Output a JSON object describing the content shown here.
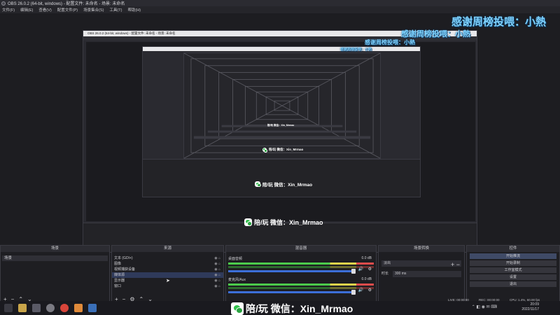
{
  "window": {
    "title": "OBS 26.0.2 (64-bit, windows) - 配置文件: 未命名 - 场景: 未命名"
  },
  "menubar": {
    "items": [
      "文件(F)",
      "编辑(E)",
      "查看(V)",
      "配置文件(P)",
      "场景集合(S)",
      "工具(T)",
      "帮助(H)"
    ]
  },
  "overlay": {
    "thanks_text": "感谢周榜投喂：小熱",
    "wechat_text": "陪/玩 微信：Xin_Mrmao"
  },
  "nested": {
    "title": "OBS 26.0.2 (64-bit, windows) - 配置文件: 未命名 - 场景: 未命名"
  },
  "docks": {
    "scenes": {
      "header": "场景",
      "items": [
        "场景"
      ]
    },
    "sources": {
      "header": "来源",
      "items": [
        {
          "label": "文本 (GDI+)",
          "selected": false
        },
        {
          "label": "图像",
          "selected": false
        },
        {
          "label": "视频捕获设备",
          "selected": false
        },
        {
          "label": "媒体源",
          "selected": true
        },
        {
          "label": "显示器",
          "selected": false
        },
        {
          "label": "窗口",
          "selected": false
        }
      ]
    },
    "mixer": {
      "header": "混音器",
      "tracks": [
        {
          "name": "桌面音频",
          "db": "0.0 dB"
        },
        {
          "name": "麦克风/Aux",
          "db": "0.0 dB"
        }
      ]
    },
    "transitions": {
      "header": "场景转换",
      "selected": "淡出",
      "duration_label": "时长",
      "duration_value": "300 ms"
    },
    "controls": {
      "header": "控件",
      "buttons": [
        "开始推流",
        "开始录制",
        "工作室模式",
        "设置",
        "退出"
      ]
    }
  },
  "status": {
    "live": "LIVE: 00:00:00",
    "rec": "REC: 00:00:00",
    "cpu": "CPU: 1.4%, 60.00 fps"
  },
  "taskbar": {
    "time": "20:09",
    "date": "2022/11/17"
  },
  "colors": {
    "accent_blue": "#3c6fd8",
    "thanks_text": "#7fd3ff",
    "wechat_green": "#32c24d"
  }
}
